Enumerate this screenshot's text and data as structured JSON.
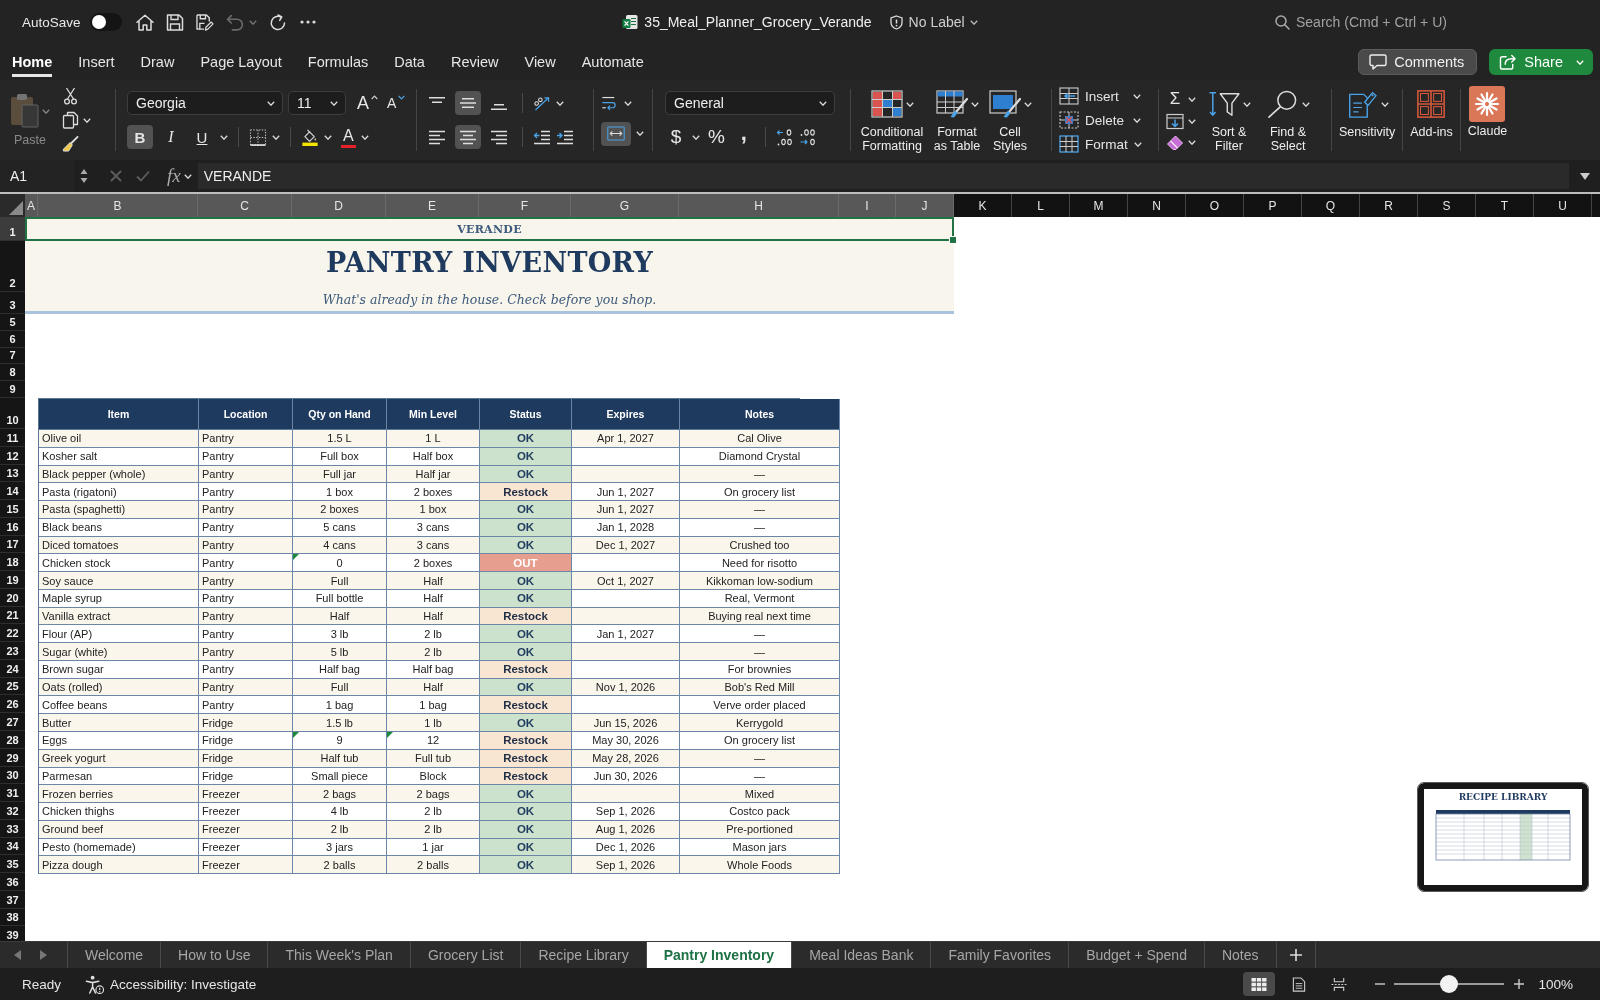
{
  "title_bar": {
    "autosave_label": "AutoSave",
    "autosave_on": false,
    "undo_disabled": true,
    "file_name": "35_Meal_Planner_Grocery_Verande",
    "sensitivity_label": "No Label",
    "search": {
      "placeholder": "Search (Cmd + Ctrl + U)"
    }
  },
  "ribbon_tabs": [
    {
      "label": "Home",
      "selected": true
    },
    {
      "label": "Insert",
      "selected": false
    },
    {
      "label": "Draw",
      "selected": false
    },
    {
      "label": "Page Layout",
      "selected": false
    },
    {
      "label": "Formulas",
      "selected": false
    },
    {
      "label": "Data",
      "selected": false
    },
    {
      "label": "Review",
      "selected": false
    },
    {
      "label": "View",
      "selected": false
    },
    {
      "label": "Automate",
      "selected": false
    }
  ],
  "comments_button": "Comments",
  "share_button": "Share",
  "ribbon": {
    "paste": {
      "label": "Paste",
      "disabled": true
    },
    "font_name": "Georgia",
    "font_size": "11",
    "grow_font": "A",
    "shrink_font": "A",
    "text_styles": [
      {
        "label": "B",
        "kind": "bold",
        "selected": true
      },
      {
        "label": "I",
        "kind": "italic",
        "selected": false
      },
      {
        "label": "U",
        "kind": "underline",
        "selected": false
      }
    ],
    "font_color": "A",
    "vertical_align": [
      {
        "kind": "top",
        "selected": false
      },
      {
        "kind": "middle",
        "selected": true
      },
      {
        "kind": "bottom",
        "selected": false
      }
    ],
    "horizontal_align": [
      {
        "kind": "left",
        "selected": false
      },
      {
        "kind": "center",
        "selected": true
      },
      {
        "kind": "right",
        "selected": false
      }
    ],
    "merge_center": {
      "selected": true
    },
    "number_format": "General",
    "number_buttons": [
      {
        "label": "$",
        "kind": "currency"
      },
      {
        "label": "%",
        "kind": "percent"
      },
      {
        "label": ",",
        "kind": "comma"
      }
    ],
    "style_buttons": [
      {
        "kind": "conditional",
        "label": "Conditional Formatting"
      },
      {
        "kind": "table",
        "label": "Format as Table"
      },
      {
        "kind": "styles",
        "label": "Cell Styles"
      }
    ],
    "cell_buttons": [
      {
        "kind": "insert",
        "label": "Insert"
      },
      {
        "kind": "delete",
        "label": "Delete"
      },
      {
        "kind": "format",
        "label": "Format"
      }
    ],
    "autosum": "Σ",
    "edit_buttons": [
      {
        "kind": "sort",
        "label": "Sort & Filter"
      },
      {
        "kind": "find",
        "label": "Find & Select"
      }
    ],
    "extra_buttons": [
      {
        "kind": "sensitivity",
        "label": "Sensitivity"
      },
      {
        "kind": "addins",
        "label": "Add-ins"
      },
      {
        "kind": "claude",
        "label": "Claude"
      }
    ]
  },
  "formula_bar": {
    "name_box": "A1",
    "edit_disabled": true,
    "function_label": "fx",
    "formula": "VERANDE"
  },
  "sheet": {
    "columns": [
      {
        "label": "A",
        "selected": true
      },
      {
        "label": "B",
        "selected": true
      },
      {
        "label": "C",
        "selected": true
      },
      {
        "label": "D",
        "selected": true
      },
      {
        "label": "E",
        "selected": true
      },
      {
        "label": "F",
        "selected": true
      },
      {
        "label": "G",
        "selected": true
      },
      {
        "label": "H",
        "selected": true
      },
      {
        "label": "I",
        "selected": true
      },
      {
        "label": "J",
        "selected": true
      },
      {
        "label": "K",
        "selected": false
      },
      {
        "label": "L",
        "selected": false
      },
      {
        "label": "M",
        "selected": false
      },
      {
        "label": "N",
        "selected": false
      },
      {
        "label": "O",
        "selected": false
      },
      {
        "label": "P",
        "selected": false
      },
      {
        "label": "Q",
        "selected": false
      },
      {
        "label": "R",
        "selected": false
      },
      {
        "label": "S",
        "selected": false
      },
      {
        "label": "T",
        "selected": false
      },
      {
        "label": "U",
        "selected": false
      }
    ],
    "rows": [
      {
        "label": "1",
        "selected": true
      },
      {
        "label": "2",
        "selected": false
      },
      {
        "label": "3",
        "selected": false
      },
      {
        "label": "5",
        "selected": false
      },
      {
        "label": "6",
        "selected": false
      },
      {
        "label": "7",
        "selected": false
      },
      {
        "label": "8",
        "selected": false
      },
      {
        "label": "9",
        "selected": false
      },
      {
        "label": "10",
        "selected": false
      },
      {
        "label": "11",
        "selected": false
      },
      {
        "label": "12",
        "selected": false
      },
      {
        "label": "13",
        "selected": false
      },
      {
        "label": "14",
        "selected": false
      },
      {
        "label": "15",
        "selected": false
      },
      {
        "label": "16",
        "selected": false
      },
      {
        "label": "17",
        "selected": false
      },
      {
        "label": "18",
        "selected": false
      },
      {
        "label": "19",
        "selected": false
      },
      {
        "label": "20",
        "selected": false
      },
      {
        "label": "21",
        "selected": false
      },
      {
        "label": "22",
        "selected": false
      },
      {
        "label": "23",
        "selected": false
      },
      {
        "label": "24",
        "selected": false
      },
      {
        "label": "25",
        "selected": false
      },
      {
        "label": "26",
        "selected": false
      },
      {
        "label": "27",
        "selected": false
      },
      {
        "label": "28",
        "selected": false
      },
      {
        "label": "29",
        "selected": false
      },
      {
        "label": "30",
        "selected": false
      },
      {
        "label": "31",
        "selected": false
      },
      {
        "label": "32",
        "selected": false
      },
      {
        "label": "33",
        "selected": false
      },
      {
        "label": "34",
        "selected": false
      },
      {
        "label": "35",
        "selected": false
      },
      {
        "label": "36",
        "selected": false
      },
      {
        "label": "37",
        "selected": false
      },
      {
        "label": "38",
        "selected": false
      },
      {
        "label": "39",
        "selected": false
      }
    ],
    "banner": {
      "brand": "VERANDE",
      "brand_selected": true,
      "title": "PANTRY INVENTORY",
      "subtitle": "What's already in the house. Check before you shop."
    },
    "table": {
      "columns": [
        "Item",
        "Location",
        "Qty on Hand",
        "Min Level",
        "Status",
        "Expires",
        "Notes"
      ],
      "rows": [
        {
          "item": "Olive oil",
          "location": "Pantry",
          "qty": "1.5 L",
          "qty_flagged": false,
          "min_level": "1 L",
          "min_flagged": false,
          "status": {
            "text": "OK",
            "kind": "ok"
          },
          "expires": "Apr 1, 2027",
          "notes": "Cal Olive"
        },
        {
          "item": "Kosher salt",
          "location": "Pantry",
          "qty": "Full box",
          "qty_flagged": false,
          "min_level": "Half box",
          "min_flagged": false,
          "status": {
            "text": "OK",
            "kind": "ok"
          },
          "notes": "Diamond Crystal"
        },
        {
          "item": "Black pepper (whole)",
          "location": "Pantry",
          "qty": "Full jar",
          "qty_flagged": false,
          "min_level": "Half jar",
          "min_flagged": false,
          "status": {
            "text": "OK",
            "kind": "ok"
          },
          "notes": "—"
        },
        {
          "item": "Pasta (rigatoni)",
          "location": "Pantry",
          "qty": "1 box",
          "qty_flagged": false,
          "min_level": "2 boxes",
          "min_flagged": false,
          "status": {
            "text": "Restock",
            "kind": "restock"
          },
          "expires": "Jun 1, 2027",
          "notes": "On grocery list"
        },
        {
          "item": "Pasta (spaghetti)",
          "location": "Pantry",
          "qty": "2 boxes",
          "qty_flagged": false,
          "min_level": "1 box",
          "min_flagged": false,
          "status": {
            "text": "OK",
            "kind": "ok"
          },
          "expires": "Jun 1, 2027",
          "notes": "—"
        },
        {
          "item": "Black beans",
          "location": "Pantry",
          "qty": "5 cans",
          "qty_flagged": false,
          "min_level": "3 cans",
          "min_flagged": false,
          "status": {
            "text": "OK",
            "kind": "ok"
          },
          "expires": "Jan 1, 2028",
          "notes": "—"
        },
        {
          "item": "Diced tomatoes",
          "location": "Pantry",
          "qty": "4 cans",
          "qty_flagged": false,
          "min_level": "3 cans",
          "min_flagged": false,
          "status": {
            "text": "OK",
            "kind": "ok"
          },
          "expires": "Dec 1, 2027",
          "notes": "Crushed too"
        },
        {
          "item": "Chicken stock",
          "location": "Pantry",
          "qty": "0",
          "qty_flagged": true,
          "min_level": "2 boxes",
          "min_flagged": false,
          "status": {
            "text": "OUT",
            "kind": "out"
          },
          "notes": "Need for risotto"
        },
        {
          "item": "Soy sauce",
          "location": "Pantry",
          "qty": "Full",
          "qty_flagged": false,
          "min_level": "Half",
          "min_flagged": false,
          "status": {
            "text": "OK",
            "kind": "ok"
          },
          "expires": "Oct 1, 2027",
          "notes": "Kikkoman low-sodium"
        },
        {
          "item": "Maple syrup",
          "location": "Pantry",
          "qty": "Full bottle",
          "qty_flagged": false,
          "min_level": "Half",
          "min_flagged": false,
          "status": {
            "text": "OK",
            "kind": "ok"
          },
          "notes": "Real, Vermont"
        },
        {
          "item": "Vanilla extract",
          "location": "Pantry",
          "qty": "Half",
          "qty_flagged": false,
          "min_level": "Half",
          "min_flagged": false,
          "status": {
            "text": "Restock",
            "kind": "restock"
          },
          "notes": "Buying real next time"
        },
        {
          "item": "Flour (AP)",
          "location": "Pantry",
          "qty": "3 lb",
          "qty_flagged": false,
          "min_level": "2 lb",
          "min_flagged": false,
          "status": {
            "text": "OK",
            "kind": "ok"
          },
          "expires": "Jan 1, 2027",
          "notes": "—"
        },
        {
          "item": "Sugar (white)",
          "location": "Pantry",
          "qty": "5 lb",
          "qty_flagged": false,
          "min_level": "2 lb",
          "min_flagged": false,
          "status": {
            "text": "OK",
            "kind": "ok"
          },
          "notes": "—"
        },
        {
          "item": "Brown sugar",
          "location": "Pantry",
          "qty": "Half bag",
          "qty_flagged": false,
          "min_level": "Half bag",
          "min_flagged": false,
          "status": {
            "text": "Restock",
            "kind": "restock"
          },
          "notes": "For brownies"
        },
        {
          "item": "Oats (rolled)",
          "location": "Pantry",
          "qty": "Full",
          "qty_flagged": false,
          "min_level": "Half",
          "min_flagged": false,
          "status": {
            "text": "OK",
            "kind": "ok"
          },
          "expires": "Nov 1, 2026",
          "notes": "Bob's Red Mill"
        },
        {
          "item": "Coffee beans",
          "location": "Pantry",
          "qty": "1 bag",
          "qty_flagged": false,
          "min_level": "1 bag",
          "min_flagged": false,
          "status": {
            "text": "Restock",
            "kind": "restock"
          },
          "notes": "Verve order placed"
        },
        {
          "item": "Butter",
          "location": "Fridge",
          "qty": "1.5 lb",
          "qty_flagged": false,
          "min_level": "1 lb",
          "min_flagged": false,
          "status": {
            "text": "OK",
            "kind": "ok"
          },
          "expires": "Jun 15, 2026",
          "notes": "Kerrygold"
        },
        {
          "item": "Eggs",
          "location": "Fridge",
          "qty": "9",
          "qty_flagged": true,
          "min_level": "12",
          "min_flagged": true,
          "status": {
            "text": "Restock",
            "kind": "restock"
          },
          "expires": "May 30, 2026",
          "notes": "On grocery list"
        },
        {
          "item": "Greek yogurt",
          "location": "Fridge",
          "qty": "Half tub",
          "qty_flagged": false,
          "min_level": "Full tub",
          "min_flagged": false,
          "status": {
            "text": "Restock",
            "kind": "restock"
          },
          "expires": "May 28, 2026",
          "notes": "—"
        },
        {
          "item": "Parmesan",
          "location": "Fridge",
          "qty": "Small piece",
          "qty_flagged": false,
          "min_level": "Block",
          "min_flagged": false,
          "status": {
            "text": "Restock",
            "kind": "restock"
          },
          "expires": "Jun 30, 2026",
          "notes": "—"
        },
        {
          "item": "Frozen berries",
          "location": "Freezer",
          "qty": "2 bags",
          "qty_flagged": false,
          "min_level": "2 bags",
          "min_flagged": false,
          "status": {
            "text": "OK",
            "kind": "ok"
          },
          "notes": "Mixed"
        },
        {
          "item": "Chicken thighs",
          "location": "Freezer",
          "qty": "4 lb",
          "qty_flagged": false,
          "min_level": "2 lb",
          "min_flagged": false,
          "status": {
            "text": "OK",
            "kind": "ok"
          },
          "expires": "Sep 1, 2026",
          "notes": "Costco pack"
        },
        {
          "item": "Ground beef",
          "location": "Freezer",
          "qty": "2 lb",
          "qty_flagged": false,
          "min_level": "2 lb",
          "min_flagged": false,
          "status": {
            "text": "OK",
            "kind": "ok"
          },
          "expires": "Aug 1, 2026",
          "notes": "Pre-portioned"
        },
        {
          "item": "Pesto (homemade)",
          "location": "Freezer",
          "qty": "3 jars",
          "qty_flagged": false,
          "min_level": "1 jar",
          "min_flagged": false,
          "status": {
            "text": "OK",
            "kind": "ok"
          },
          "expires": "Dec 1, 2026",
          "notes": "Mason jars"
        },
        {
          "item": "Pizza dough",
          "location": "Freezer",
          "qty": "2 balls",
          "qty_flagged": false,
          "min_level": "2 balls",
          "min_flagged": false,
          "status": {
            "text": "OK",
            "kind": "ok"
          },
          "expires": "Sep 1, 2026",
          "notes": "Whole Foods"
        }
      ]
    }
  },
  "preview": {
    "title": "RECIPE LIBRARY"
  },
  "sheet_tabs": [
    {
      "label": "Welcome",
      "selected": false
    },
    {
      "label": "How to Use",
      "selected": false
    },
    {
      "label": "This Week's Plan",
      "selected": false
    },
    {
      "label": "Grocery List",
      "selected": false
    },
    {
      "label": "Recipe Library",
      "selected": false
    },
    {
      "label": "Pantry Inventory",
      "selected": true
    },
    {
      "label": "Meal Ideas Bank",
      "selected": false
    },
    {
      "label": "Family Favorites",
      "selected": false
    },
    {
      "label": "Budget + Spend",
      "selected": false
    },
    {
      "label": "Notes",
      "selected": false
    }
  ],
  "status_bar": {
    "mode": "Ready",
    "accessibility": "Accessibility: Investigate",
    "views": [
      {
        "kind": "normal",
        "selected": true
      },
      {
        "kind": "page_layout",
        "selected": false
      },
      {
        "kind": "page_break",
        "selected": false
      }
    ],
    "zoom": {
      "level": 0.5,
      "reading": "100%"
    }
  }
}
